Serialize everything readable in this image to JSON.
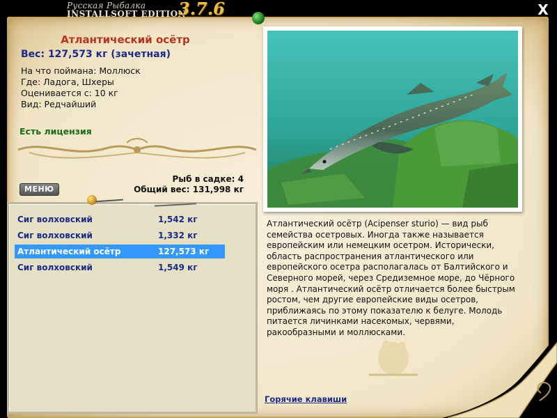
{
  "app": {
    "subtitle": "Русская Рыбалка",
    "edition": "INSTALLSOFT EDITION",
    "version": "3.7.6",
    "close_glyph": "X"
  },
  "fish": {
    "title": "Атлантический осётр",
    "weight": "Вес: 127,573 кг (зачетная)",
    "caught_on": "На что поймана: Моллюск",
    "location": "Где: Ладога, Шхеры",
    "rated_from": "Оценивается с: 10 кг",
    "rarity": "Вид: Редчайший",
    "license": "Есть лицензия"
  },
  "cage": {
    "count": "Рыб в садке: 4",
    "total": "Общий вес: 131,998 кг"
  },
  "menu_label": "МЕНЮ",
  "catch_list": [
    {
      "name": "Сиг волховский",
      "weight": "1,542 кг",
      "selected": false
    },
    {
      "name": "Сиг волховский",
      "weight": "1,332 кг",
      "selected": false
    },
    {
      "name": "Атлантический осётр",
      "weight": "127,573 кг",
      "selected": true
    },
    {
      "name": "Сиг волховский",
      "weight": "1,549 кг",
      "selected": false
    }
  ],
  "description": "Атлантический осётр (Acipenser sturio) — вид рыб семейства осетровых. Иногда также называется европейским или немецким осетром. Исторически, область распространения атлантического или европейского осетра располагалась от Балтийского и Северного морей, через Средиземное море, до Чёрного моря . Атлантический осётр отличается более быстрым ростом, чем другие европейские виды осетров, приближаясь по этому показателю к белуге. Молодь питается личинками насекомых, червями, ракообразными и моллюсками.",
  "hotkeys_label": "Горячие клавиши",
  "colors": {
    "parchment": "#f5ecd4",
    "title_red": "#b8341c",
    "link_blue": "#1a2a8a",
    "license_green": "#1a6a1a",
    "selection": "#3399ff",
    "water": "#2fa69a"
  }
}
